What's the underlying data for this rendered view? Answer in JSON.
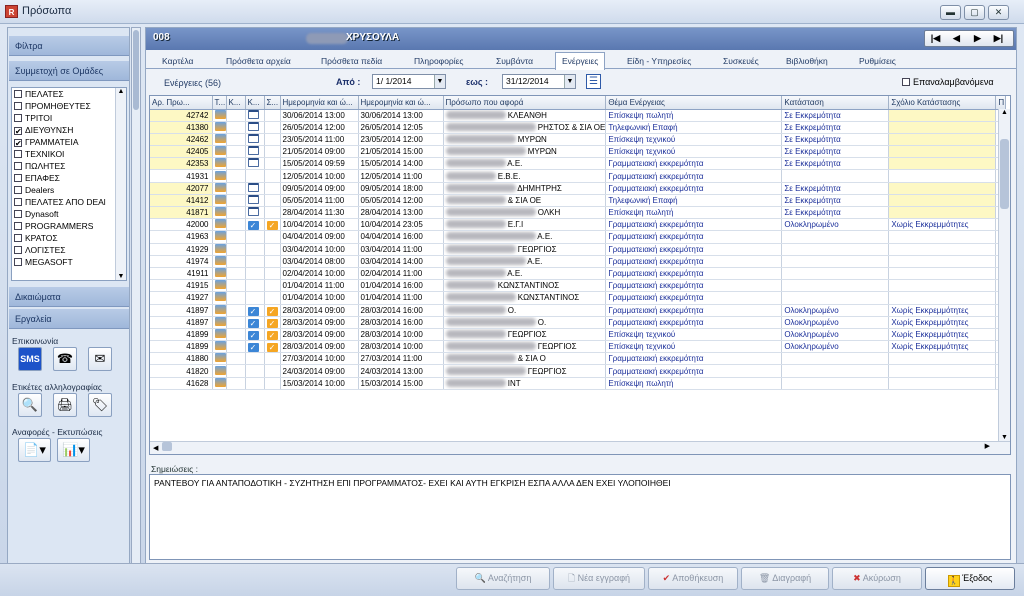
{
  "window": {
    "title": "Πρόσωπα"
  },
  "left": {
    "filters": "Φίλτρα",
    "groups_header": "Συμμετοχή σε Ομάδες",
    "groups": [
      {
        "label": "ΠΕΛΑΤΕΣ",
        "checked": false
      },
      {
        "label": "ΠΡΟΜΗΘΕΥΤΕΣ",
        "checked": false
      },
      {
        "label": "ΤΡΙΤΟΙ",
        "checked": false
      },
      {
        "label": "ΔΙΕΥΘΥΝΣΗ",
        "checked": true
      },
      {
        "label": "ΓΡΑΜΜΑΤΕΙΑ",
        "checked": true
      },
      {
        "label": "ΤΕΧΝΙΚΟΙ",
        "checked": false
      },
      {
        "label": "ΠΩΛΗΤΕΣ",
        "checked": false
      },
      {
        "label": "ΕΠΑΦΕΣ",
        "checked": false
      },
      {
        "label": "Dealers",
        "checked": false
      },
      {
        "label": "ΠΕΛΑΤΕΣ ΑΠΟ DEAl",
        "checked": false
      },
      {
        "label": "Dynasoft",
        "checked": false
      },
      {
        "label": "PROGRAMMERS",
        "checked": false
      },
      {
        "label": "ΚΡΑΤΟΣ",
        "checked": false
      },
      {
        "label": "ΛΟΓΙΣΤΕΣ",
        "checked": false
      },
      {
        "label": "MEGASOFT",
        "checked": false
      }
    ],
    "rights": "Δικαιώματα",
    "tools": "Εργαλεία",
    "comm": "Επικοινωνία",
    "labels": "Ετικέτες αλληλογραφίας",
    "reports": "Αναφορές - Εκτυπώσεις"
  },
  "header": {
    "code": "008",
    "name": "ΧΡΥΣΟΥΛΑ"
  },
  "tabs": [
    "Καρτέλα",
    "Πρόσθετα αρχεία",
    "Πρόσθετα πεδία",
    "Πληροφορίες",
    "Συμβάντα",
    "Ενέργειες",
    "Είδη - Υπηρεσίες",
    "Συσκευές",
    "Βιβλιοθήκη",
    "Ρυθμίσεις"
  ],
  "filter": {
    "count_label": "Ενέργειες (56)",
    "from_label": "Από :",
    "from": "1/ 1/2014",
    "to_label": "εως :",
    "to": "31/12/2014",
    "recurring": "Επαναλαμβανόμενα"
  },
  "columns": [
    "Αρ. Πρω...",
    "Τ...",
    "Κ...",
    "Κ...",
    "Σ...",
    "Ημερομηνία και ώ...",
    "Ημερομηνία και ώ...",
    "Πρόσωπο που αφορά",
    "Θέμα Ενέργειας",
    "Κατάσταση",
    "Σχόλιο Κατάστασης",
    "Π"
  ],
  "rows": [
    {
      "no": "42742",
      "s": "30/06/2014 13:00",
      "e": "30/06/2014 13:00",
      "p": "ΚΛΕΑΝΘΗ",
      "t": "Επίσκεψη πωλητή",
      "st": "Σε Εκκρεμότητα",
      "c": "",
      "n": true,
      "k": false,
      "y": true
    },
    {
      "no": "41380",
      "s": "26/05/2014 12:00",
      "e": "26/05/2014 12:05",
      "p": "ΡΗΣΤΟΣ & ΣΙΑ ΟΕ",
      "t": "Τηλεφωνική Επαφή",
      "st": "Σε Εκκρεμότητα",
      "c": "",
      "n": true,
      "k": false,
      "y": true
    },
    {
      "no": "42462",
      "s": "23/05/2014 11:00",
      "e": "23/05/2014 12:00",
      "p": "ΜΥΡΩΝ",
      "t": "Επίσκεψη τεχνικού",
      "st": "Σε Εκκρεμότητα",
      "c": "",
      "n": true,
      "k": false,
      "y": true
    },
    {
      "no": "42405",
      "s": "21/05/2014 09:00",
      "e": "21/05/2014 15:00",
      "p": "ΜΥΡΩΝ",
      "t": "Επίσκεψη τεχνικού",
      "st": "Σε Εκκρεμότητα",
      "c": "",
      "n": true,
      "k": false,
      "y": true
    },
    {
      "no": "42353",
      "s": "15/05/2014 09:59",
      "e": "15/05/2014 14:00",
      "p": "Α.Ε.",
      "t": "Γραμματειακή εκκρεμότητα",
      "st": "Σε Εκκρεμότητα",
      "c": "",
      "n": true,
      "k": false,
      "y": true
    },
    {
      "no": "41931",
      "s": "12/05/2014 10:00",
      "e": "12/05/2014 11:00",
      "p": "Ε.Β.Ε.",
      "t": "Γραμματειακή εκκρεμότητα",
      "st": "",
      "c": "",
      "n": false,
      "k": false,
      "y": false
    },
    {
      "no": "42077",
      "s": "09/05/2014 09:00",
      "e": "09/05/2014 18:00",
      "p": "ΔΗΜΗΤΡΗΣ",
      "t": "Γραμματειακή εκκρεμότητα",
      "st": "Σε Εκκρεμότητα",
      "c": "",
      "n": true,
      "k": false,
      "y": true
    },
    {
      "no": "41412",
      "s": "05/05/2014 11:00",
      "e": "05/05/2014 12:00",
      "p": "& ΣΙΑ ΟΕ",
      "t": "Τηλεφωνική Επαφή",
      "st": "Σε Εκκρεμότητα",
      "c": "",
      "n": true,
      "k": false,
      "y": true
    },
    {
      "no": "41871",
      "s": "28/04/2014 11:30",
      "e": "28/04/2014 13:00",
      "p": "ΟΛΚΗ",
      "t": "Επίσκεψη πωλητή",
      "st": "Σε Εκκρεμότητα",
      "c": "",
      "n": true,
      "k": false,
      "y": true
    },
    {
      "no": "42000",
      "s": "10/04/2014 10:00",
      "e": "10/04/2014 23:05",
      "p": "Ε.Γ.Ι",
      "t": "Γραμματειακή εκκρεμότητα",
      "st": "Ολοκληρωμένο",
      "c": "Χωρίς Εκκρεμμότητες",
      "n": false,
      "k": true,
      "y": false
    },
    {
      "no": "41963",
      "s": "04/04/2014 09:00",
      "e": "04/04/2014 16:00",
      "p": "Α.Ε.",
      "t": "Γραμματειακή εκκρεμότητα",
      "st": "",
      "c": "",
      "n": false,
      "k": false,
      "y": false
    },
    {
      "no": "41929",
      "s": "03/04/2014 10:00",
      "e": "03/04/2014 11:00",
      "p": "ΓΕΩΡΓΙΟΣ",
      "t": "Γραμματειακή εκκρεμότητα",
      "st": "",
      "c": "",
      "n": false,
      "k": false,
      "y": false
    },
    {
      "no": "41974",
      "s": "03/04/2014 08:00",
      "e": "03/04/2014 14:00",
      "p": "Α.Ε.",
      "t": "Γραμματειακή εκκρεμότητα",
      "st": "",
      "c": "",
      "n": false,
      "k": false,
      "y": false
    },
    {
      "no": "41911",
      "s": "02/04/2014 10:00",
      "e": "02/04/2014 11:00",
      "p": "Α.Ε.",
      "t": "Γραμματειακή εκκρεμότητα",
      "st": "",
      "c": "",
      "n": false,
      "k": false,
      "y": false
    },
    {
      "no": "41915",
      "s": "01/04/2014 11:00",
      "e": "01/04/2014 16:00",
      "p": "ΚΩΝΣΤΑΝΤΙΝΟΣ",
      "t": "Γραμματειακή εκκρεμότητα",
      "st": "",
      "c": "",
      "n": false,
      "k": false,
      "y": false
    },
    {
      "no": "41927",
      "s": "01/04/2014 10:00",
      "e": "01/04/2014 11:00",
      "p": "ΚΩΝΣΤΑΝΤΙΝΟΣ",
      "t": "Γραμματειακή εκκρεμότητα",
      "st": "",
      "c": "",
      "n": false,
      "k": false,
      "y": false
    },
    {
      "no": "41897",
      "s": "28/03/2014 09:00",
      "e": "28/03/2014 16:00",
      "p": "Ο.",
      "t": "Γραμματειακή εκκρεμότητα",
      "st": "Ολοκληρωμένο",
      "c": "Χωρίς Εκκρεμμότητες",
      "n": false,
      "k": true,
      "y": false
    },
    {
      "no": "41897",
      "s": "28/03/2014 09:00",
      "e": "28/03/2014 16:00",
      "p": "Ο.",
      "t": "Γραμματειακή εκκρεμότητα",
      "st": "Ολοκληρωμένο",
      "c": "Χωρίς Εκκρεμμότητες",
      "n": false,
      "k": true,
      "y": false
    },
    {
      "no": "41899",
      "s": "28/03/2014 09:00",
      "e": "28/03/2014 10:00",
      "p": "ΓΕΩΡΓΙΟΣ",
      "t": "Επίσκεψη τεχνικού",
      "st": "Ολοκληρωμένο",
      "c": "Χωρίς Εκκρεμμότητες",
      "n": false,
      "k": true,
      "y": false
    },
    {
      "no": "41899",
      "s": "28/03/2014 09:00",
      "e": "28/03/2014 10:00",
      "p": "ΓΕΩΡΓΙΟΣ",
      "t": "Επίσκεψη τεχνικού",
      "st": "Ολοκληρωμένο",
      "c": "Χωρίς Εκκρεμμότητες",
      "n": false,
      "k": true,
      "y": false
    },
    {
      "no": "41880",
      "s": "27/03/2014 10:00",
      "e": "27/03/2014 11:00",
      "p": "& ΣΙΑ Ο",
      "t": "Γραμματειακή εκκρεμότητα",
      "st": "",
      "c": "",
      "n": false,
      "k": false,
      "y": false
    },
    {
      "no": "41820",
      "s": "24/03/2014 09:00",
      "e": "24/03/2014 13:00",
      "p": "ΓΕΩΡΓΙΟΣ",
      "t": "Γραμματειακή εκκρεμότητα",
      "st": "",
      "c": "",
      "n": false,
      "k": false,
      "y": false
    },
    {
      "no": "41628",
      "s": "15/03/2014 10:00",
      "e": "15/03/2014 15:00",
      "p": "ΙΝΤ",
      "t": "Επίσκεψη πωλητή",
      "st": "",
      "c": "",
      "n": false,
      "k": false,
      "y": false
    }
  ],
  "notes": {
    "label": "Σημειώσεις :",
    "text": "ΡΑΝΤΕΒΟΥ ΓΙΑ ΑΝΤΑΠΟΔΟΤΙΚΗ - ΣΥΖΗΤΗΣΗ ΕΠΙ ΠΡΟΓΡΑΜΜΑΤΟΣ- ΕΧΕΙ ΚΑΙ ΑΥΤΗ ΕΓΚΡΙΣΗ ΕΣΠΑ ΑΛΛΑ ΔΕΝ ΕΧΕΙ ΥΛΟΠΟΙΗΘΕΙ"
  },
  "buttons": {
    "search": "Αναζήτηση",
    "new": "Νέα εγγραφή",
    "save": "Αποθήκευση",
    "delete": "Διαγραφή",
    "cancel": "Ακύρωση",
    "exit": "Έξοδος"
  }
}
